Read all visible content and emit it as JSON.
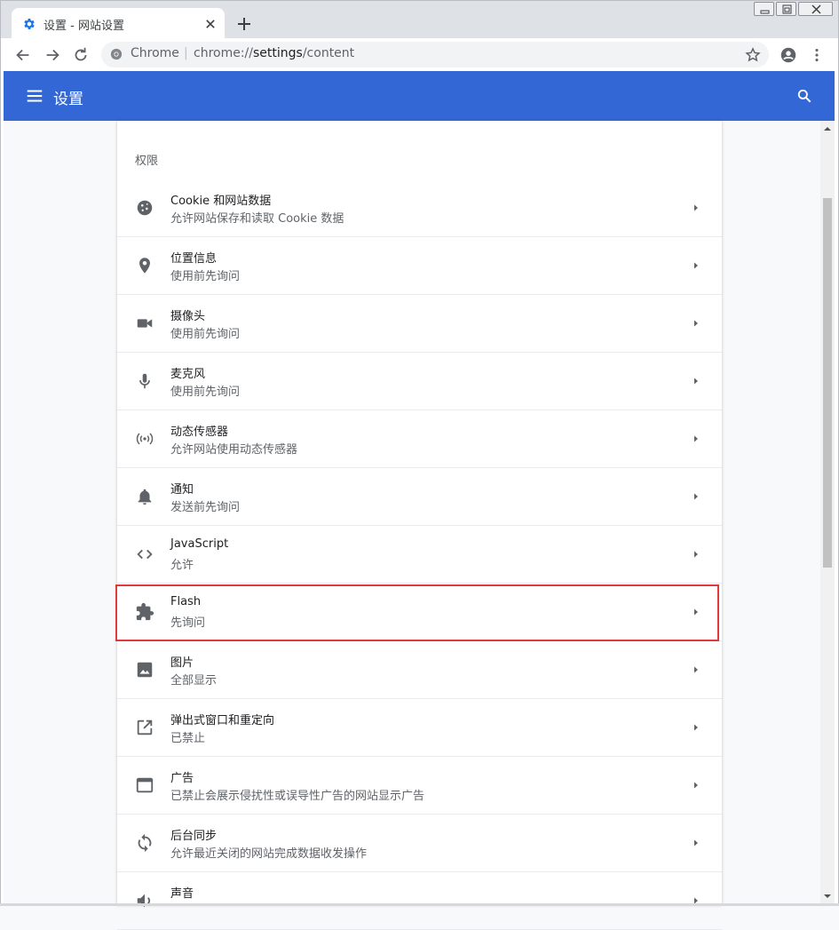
{
  "tab": {
    "title": "设置 - 网站设置"
  },
  "omnibox": {
    "label": "Chrome",
    "separator": "|",
    "url_scheme": "chrome://",
    "url_host": "settings",
    "url_path": "/content"
  },
  "header": {
    "title": "设置"
  },
  "section": {
    "title": "权限"
  },
  "colors": {
    "accent": "#3367d6",
    "highlight": "#e0393e"
  },
  "rows": [
    {
      "title": "Cookie 和网站数据",
      "subtitle": "允许网站保存和读取 Cookie 数据",
      "icon": "cookie-icon"
    },
    {
      "title": "位置信息",
      "subtitle": "使用前先询问",
      "icon": "location-icon"
    },
    {
      "title": "摄像头",
      "subtitle": "使用前先询问",
      "icon": "camera-icon"
    },
    {
      "title": "麦克风",
      "subtitle": "使用前先询问",
      "icon": "microphone-icon"
    },
    {
      "title": "动态传感器",
      "subtitle": "允许网站使用动态传感器",
      "icon": "sensors-icon"
    },
    {
      "title": "通知",
      "subtitle": "发送前先询问",
      "icon": "bell-icon"
    },
    {
      "title": "JavaScript",
      "subtitle": "允许",
      "icon": "code-icon"
    },
    {
      "title": "Flash",
      "subtitle": "先询问",
      "icon": "puzzle-icon"
    },
    {
      "title": "图片",
      "subtitle": "全部显示",
      "icon": "image-icon"
    },
    {
      "title": "弹出式窗口和重定向",
      "subtitle": "已禁止",
      "icon": "open-in-new-icon"
    },
    {
      "title": "广告",
      "subtitle": "已禁止会展示侵扰性或误导性广告的网站显示广告",
      "icon": "ad-window-icon"
    },
    {
      "title": "后台同步",
      "subtitle": "允许最近关闭的网站完成数据收发操作",
      "icon": "sync-icon"
    },
    {
      "title": "声音",
      "subtitle": "",
      "icon": "volume-icon"
    }
  ]
}
